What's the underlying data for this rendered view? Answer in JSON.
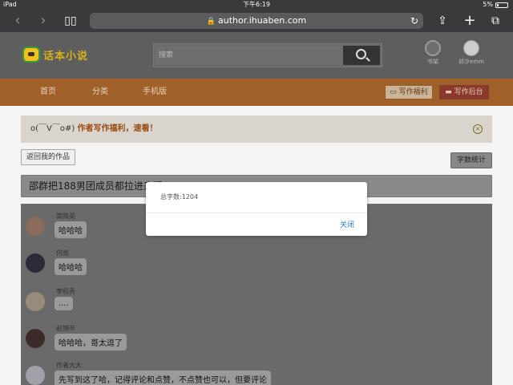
{
  "status_bar": {
    "device": "iPad",
    "time": "下午6:19",
    "battery": "5%"
  },
  "browser": {
    "url": "author.ihuaben.com"
  },
  "header": {
    "logo_text": "话本小说",
    "search_placeholder": "搜索",
    "shelf_label": "书架",
    "user_label": "祁汐emm"
  },
  "nav": {
    "items": [
      "首页",
      "分类",
      "手机版"
    ],
    "write_welfare": "写作福利",
    "write_backend": "写作后台"
  },
  "notice": {
    "emote": "o(￣V￣o#)",
    "text": "作者写作福利，速看！"
  },
  "buttons": {
    "back": "返回我的作品",
    "count": "字数统计"
  },
  "work_title": "邵群把188男团成员都拉进来睡",
  "messages": [
    {
      "name": "简隋英",
      "text": "哈哈哈"
    },
    {
      "name": "何故",
      "text": "哈哈哈"
    },
    {
      "name": "李程秀",
      "text": "...."
    },
    {
      "name": "赵锦辛",
      "text": "哈哈哈，哥太逗了"
    },
    {
      "name": "作者大大",
      "text": "先写到这了哈，记得评论和点赞，不点赞也可以，但要评论"
    }
  ],
  "modal": {
    "text": "总字数:1204",
    "close": "关闭"
  }
}
